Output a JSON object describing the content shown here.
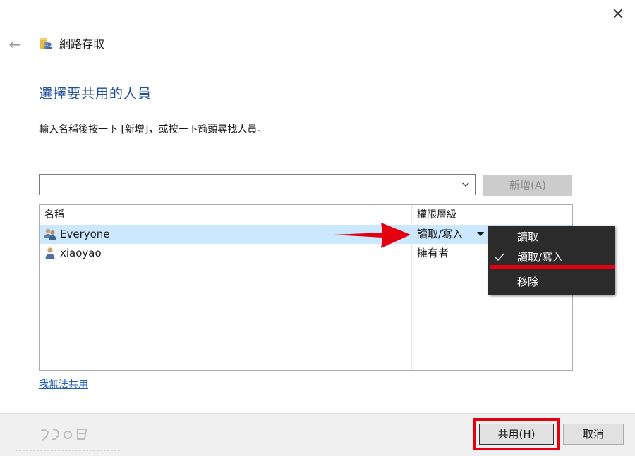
{
  "window": {
    "title": "網路存取",
    "back_icon": "back-arrow-icon",
    "close_icon": "close-icon"
  },
  "main": {
    "heading": "選擇要共用的人員",
    "instruction": "輸入名稱後按一下 [新增]，或按一下箭頭尋找人員。",
    "name_input": {
      "value": "",
      "placeholder": ""
    },
    "add_button": "新增(A)"
  },
  "list": {
    "columns": [
      "名稱",
      "權限層級"
    ],
    "rows": [
      {
        "name": "Everyone",
        "permission": "讀取/寫入",
        "icon": "users-group-icon",
        "selected": true
      },
      {
        "name": "xiaoyao",
        "permission": "擁有者",
        "icon": "user-icon",
        "selected": false
      }
    ]
  },
  "permission_menu": {
    "items": [
      {
        "label": "讀取",
        "checked": false
      },
      {
        "label": "讀取/寫入",
        "checked": true
      },
      {
        "label": "移除",
        "checked": false
      }
    ]
  },
  "link": {
    "cant_share": "我無法共用"
  },
  "footer": {
    "share_button": "共用(H)",
    "cancel_button": "取消"
  },
  "colors": {
    "heading": "#1f4e9c",
    "selection": "#cce8ff",
    "annotation_red": "#e3000f",
    "menu_bg": "#2b2b2b"
  }
}
